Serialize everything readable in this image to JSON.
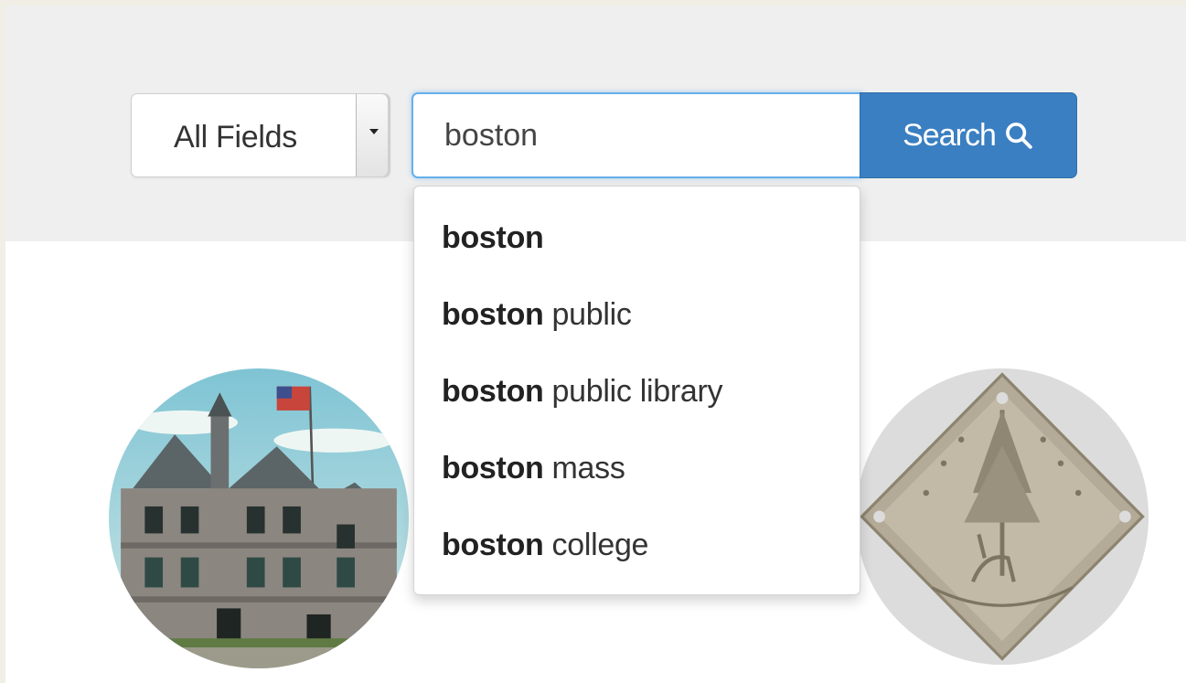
{
  "search": {
    "field_select_label": "All Fields",
    "query": "boston",
    "button_label": "Search"
  },
  "suggestions": [
    {
      "bold": "boston",
      "rest": ""
    },
    {
      "bold": "boston",
      "rest": "public"
    },
    {
      "bold": "boston",
      "rest": "public library"
    },
    {
      "bold": "boston",
      "rest": "mass"
    },
    {
      "bold": "boston",
      "rest": "college"
    }
  ],
  "thumbnails": [
    {
      "subject": "stone-building-with-flag"
    },
    {
      "subject": "diamond-shaped-silver-medal"
    }
  ],
  "colors": {
    "band": "#efefef",
    "button": "#3a7fc1",
    "focus_border": "#66afe9"
  }
}
